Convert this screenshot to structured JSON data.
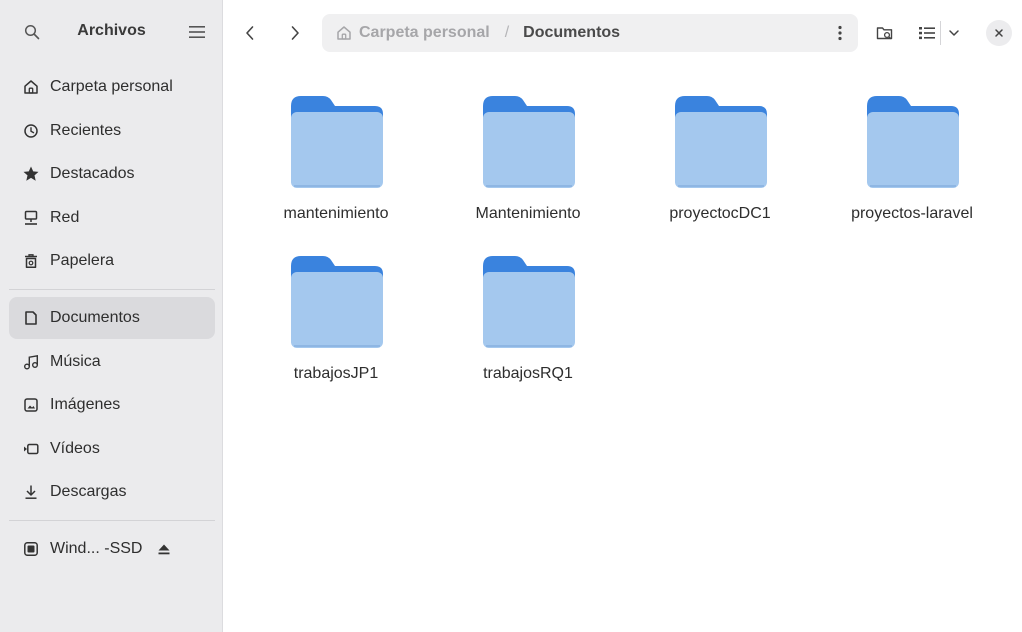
{
  "sidebar": {
    "title": "Archivos",
    "places": [
      {
        "label": "Carpeta personal",
        "icon": "home-icon"
      },
      {
        "label": "Recientes",
        "icon": "clock-icon"
      },
      {
        "label": "Destacados",
        "icon": "star-icon"
      },
      {
        "label": "Red",
        "icon": "network-icon"
      },
      {
        "label": "Papelera",
        "icon": "trash-icon"
      }
    ],
    "bookmarks": [
      {
        "label": "Documentos",
        "icon": "document-icon",
        "active": true
      },
      {
        "label": "Música",
        "icon": "music-icon"
      },
      {
        "label": "Imágenes",
        "icon": "image-icon"
      },
      {
        "label": "Vídeos",
        "icon": "video-icon"
      },
      {
        "label": "Descargas",
        "icon": "download-icon"
      }
    ],
    "devices": [
      {
        "label": "Wind... -SSD",
        "icon": "drive-icon",
        "eject": true
      }
    ]
  },
  "path": {
    "parent": "Carpeta personal",
    "separator": "/",
    "current": "Documentos"
  },
  "folders": [
    {
      "name": "mantenimiento"
    },
    {
      "name": "Mantenimiento"
    },
    {
      "name": "proyectocDC1"
    },
    {
      "name": "proyectos-laravel"
    },
    {
      "name": "trabajosJP1"
    },
    {
      "name": "trabajosRQ1"
    }
  ],
  "colors": {
    "sidebar_bg": "#ebebed",
    "active_item": "#dadadd",
    "folder_front": "#a4c8ee",
    "folder_back": "#3a83de"
  }
}
